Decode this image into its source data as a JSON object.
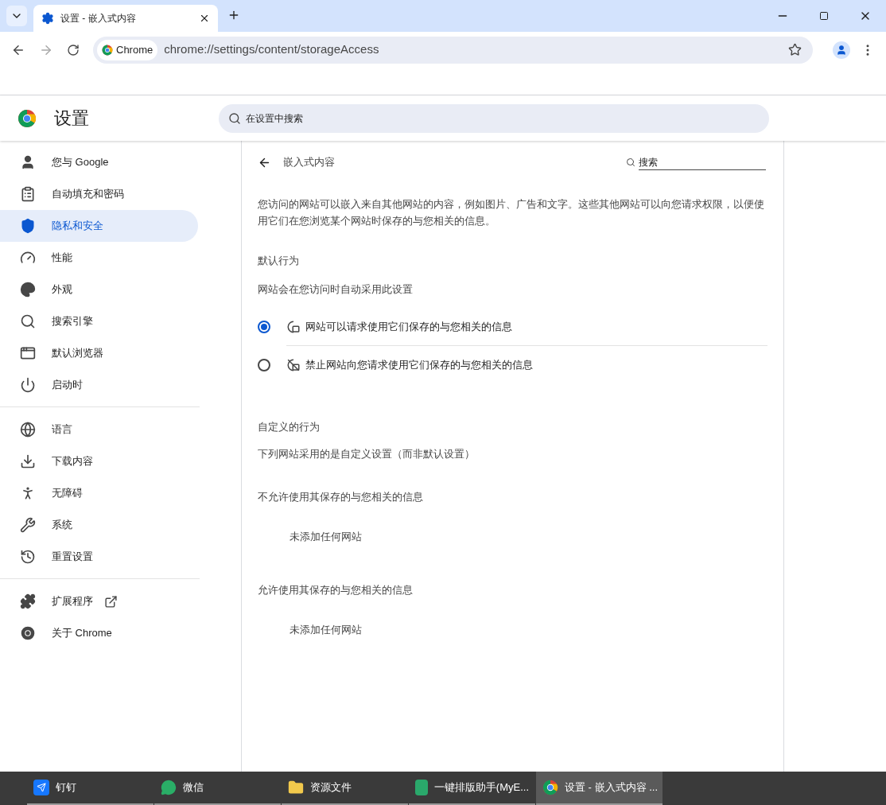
{
  "browser": {
    "tabs": [
      {
        "title": "设置 - 嵌入式内容",
        "selected": true
      }
    ],
    "address": {
      "chip": "Chrome",
      "url": "chrome://settings/content/storageAccess"
    }
  },
  "settings_header": {
    "title": "设置",
    "search": {
      "placeholder": "在设置中搜索"
    }
  },
  "sidebar": {
    "groups": [
      {
        "items": [
          {
            "label": "您与 Google",
            "selected": false,
            "kind": "page"
          },
          {
            "label": "自动填充和密码",
            "selected": false,
            "kind": "page"
          },
          {
            "label": "隐私和安全",
            "selected": true,
            "kind": "page"
          },
          {
            "label": "性能",
            "selected": false,
            "kind": "page"
          },
          {
            "label": "外观",
            "selected": false,
            "kind": "page"
          },
          {
            "label": "搜索引擎",
            "selected": false,
            "kind": "page"
          },
          {
            "label": "默认浏览器",
            "selected": false,
            "kind": "page"
          },
          {
            "label": "启动时",
            "selected": false,
            "kind": "page"
          }
        ]
      },
      {
        "items": [
          {
            "label": "语言",
            "selected": false,
            "kind": "page"
          },
          {
            "label": "下载内容",
            "selected": false,
            "kind": "page"
          },
          {
            "label": "无障碍",
            "selected": false,
            "kind": "page"
          },
          {
            "label": "系统",
            "selected": false,
            "kind": "page"
          },
          {
            "label": "重置设置",
            "selected": false,
            "kind": "page"
          }
        ]
      },
      {
        "items": [
          {
            "label": "扩展程序",
            "selected": false,
            "kind": "external"
          },
          {
            "label": "关于 Chrome",
            "selected": false,
            "kind": "page"
          }
        ]
      }
    ]
  },
  "content": {
    "title": "嵌入式内容",
    "search": {
      "placeholder": "搜索"
    },
    "description": "您访问的网站可以嵌入来自其他网站的内容，例如图片、广告和文字。这些其他网站可以向您请求权限，以便使用它们在您浏览某个网站时保存的与您相关的信息。",
    "default_behavior": {
      "heading": "默认行为",
      "subtitle": "网站会在您访问时自动采用此设置",
      "options": [
        {
          "label": "网站可以请求使用它们保存的与您相关的信息",
          "selected": true,
          "kind": "allow"
        },
        {
          "label": "禁止网站向您请求使用它们保存的与您相关的信息",
          "selected": false,
          "kind": "block"
        }
      ]
    },
    "custom_behavior": {
      "heading": "自定义的行为",
      "subtitle": "下列网站采用的是自定义设置（而非默认设置）",
      "lists": [
        {
          "heading": "不允许使用其保存的与您相关的信息",
          "empty_text": "未添加任何网站"
        },
        {
          "heading": "允许使用其保存的与您相关的信息",
          "empty_text": "未添加任何网站"
        }
      ]
    }
  },
  "taskbar": {
    "items": [
      {
        "label": "钉钉",
        "selected": false
      },
      {
        "label": "微信",
        "selected": false
      },
      {
        "label": "资源文件",
        "selected": false
      },
      {
        "label": "一键排版助手(MyE...",
        "selected": false
      },
      {
        "label": "设置 - 嵌入式内容 ...",
        "selected": true
      }
    ]
  }
}
